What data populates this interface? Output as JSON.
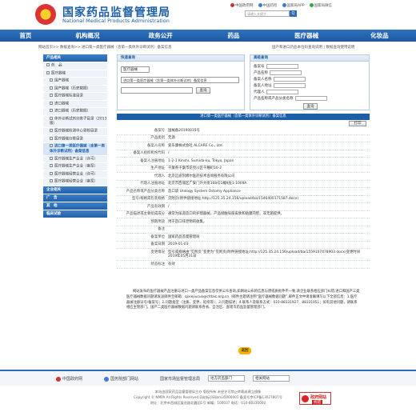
{
  "header": {
    "site_title": "国家药品监督管理局",
    "site_subtitle": "National Medical Products Administration",
    "top_links": [
      "中国政府网",
      "中国药检",
      "国家局APP",
      "国家局微信"
    ],
    "search_placeholder": "请输入关键字",
    "search_button": "Q"
  },
  "nav": [
    "首页",
    "机构概况",
    "政务公开",
    "药品",
    "医疗器械",
    "化妆品"
  ],
  "breadcrumb": "网站首页>> 数据查询>> 进口第一类医疗器械（含第一类体外诊断试剂）备案信息",
  "quick_links": "国产和进口药品本位码查询说明 | 数据查询使用说明",
  "sidebar": {
    "groups": [
      {
        "title": "产品相关",
        "items": [
          {
            "label": "药　品",
            "level": 0
          },
          {
            "label": "医疗器械",
            "level": 0
          },
          {
            "label": "国产器械",
            "level": 1
          },
          {
            "label": "国产器械（历史数据）",
            "level": 1
          },
          {
            "label": "医疗器械标准目录",
            "level": 1
          },
          {
            "label": "进口器械",
            "level": 1
          },
          {
            "label": "进口器械（历史数据）",
            "level": 1
          },
          {
            "label": "体外诊断试剂分类子目录（2013版）",
            "level": 1
          },
          {
            "label": "医疗器械检测中心受检目录",
            "level": 1
          },
          {
            "label": "医疗器械分类目录",
            "level": 1
          },
          {
            "label": "进口第一类医疗器械（含第一类体外诊断试剂）备案信息",
            "level": 1,
            "active": true
          },
          {
            "label": "医疗器械生产企业（许可）",
            "level": 1
          },
          {
            "label": "医疗器械生产企业（备案）",
            "level": 1
          },
          {
            "label": "医疗器械经营企业（许可）",
            "level": 1
          },
          {
            "label": "医疗器械经营企业（备案）",
            "level": 1
          }
        ]
      },
      {
        "title": "企业相关",
        "items": []
      },
      {
        "title": "广　告",
        "items": []
      },
      {
        "title": "其　他",
        "items": []
      },
      {
        "title": "临床试验",
        "items": []
      }
    ]
  },
  "query_left": {
    "title": "快速查询",
    "category_select": "医疗器械",
    "db_select": "进口第一类医疗器械（含第一类体外诊断试剂）备案信息",
    "query_button": "查询"
  },
  "query_right": {
    "title": "高级查询",
    "fields": [
      "备案号",
      "产品名称",
      "备案人名称",
      "备案人地址",
      "代理人",
      "产品名称或产品分类名称"
    ],
    "query_button": "查询"
  },
  "detail": {
    "title": "进口第一类医疗器械（含第一类体外诊断试剂）备案信息",
    "print_button": "打印",
    "rows": [
      {
        "k": "备案号",
        "v": "国械备20190015号"
      },
      {
        "k": "产品类别",
        "v": "无源"
      },
      {
        "k": "备案人名称",
        "v": "爱乐康株式会社 ALCARE Co., Ltd."
      },
      {
        "k": "备案人组织机构代码",
        "v": "/"
      },
      {
        "k": "备案人注册地址",
        "v": "1-2-1 Kinshi, Sumida-ku, Tokyo, Japan"
      },
      {
        "k": "生产地址",
        "v": "千葉県千葉市花見川区千種町16-2"
      },
      {
        "k": "代理人",
        "v": "北京迈迪凯姆尔医药技术咨询服务有限公司"
      },
      {
        "k": "代理人注册地址",
        "v": "北京市西城区广安门外大街168号1幢9层1-1009A"
      },
      {
        "k": "产品名称或产品分类名称",
        "v": "造口袋 Urology System Ostomy Appliance"
      },
      {
        "k": "型号/规格或包装规格",
        "v": "见附页(附件链接地址:http://125.35.24.156/upload/ba/1546400171587.docx)"
      },
      {
        "k": "产品有效期",
        "v": "/"
      },
      {
        "k": "产品描述或主要组成成分",
        "v": "通常为尿道造口的护理器械。产品接触局部皮肤和粘膜内腔。非无菌提供。"
      },
      {
        "k": "预期用途",
        "v": "用于造口排泄物的收集。"
      },
      {
        "k": "备注",
        "v": ""
      },
      {
        "k": "备案单位",
        "v": "国家药品监督管理局"
      },
      {
        "k": "备案日期",
        "v": "2019-01-03"
      },
      {
        "k": "变更情况",
        "v": "型号或规格由“见附页”变更为“见附页(附件链接地址:http://125.35.24.156/upload/ba/1559107478903.docx)变更时间2019年05月31日"
      },
      {
        "k": "状态标注",
        "v": "有效"
      }
    ]
  },
  "notice": "网站发布的医疗器械产品注册与进口一类产品备案信息仅供公众查询,如网站公布的信息与原纸质批件不一致,请企业联系相应部门纠错;进口和国产三类医疗器械数据问题请发送邮件至邮箱：qixiejiucuo@cfdaic.org.cn（邮件主题请注明“医疗器械数据问题”,邮件正文中请准确填写以下全部信息：1.医疗器械注册证号/备案号；2.问题类型（注册、变更、延续等）；3.问题描述；4.联系人及联系方式：010-88331927、88331951；如有其他问题，请联系相应主管部门。国产二类医疗器械数据问题请联系各省、自治区、直辖市药品监督管理部门。",
  "back_button": "返回",
  "footer": {
    "links": [
      "中国政府网",
      "国务院部门网站",
      "国家市场监督管理总局"
    ],
    "select1": "地方药监部门",
    "select2": "相关网站",
    "info1": "本站由国家药品监督管理局主办  版权所有  未经许可禁止转载或建立镜像",
    "info2": "Copyright © NMPA All Rights Reserved  网站标识码bm35000001  备案号京ICP备13027807号",
    "info3": "地址：北京市西城区展览路北露园1号  邮编：100037  电话：010-88330000",
    "badge_line1": "政府网站",
    "badge_line2": "找错"
  }
}
